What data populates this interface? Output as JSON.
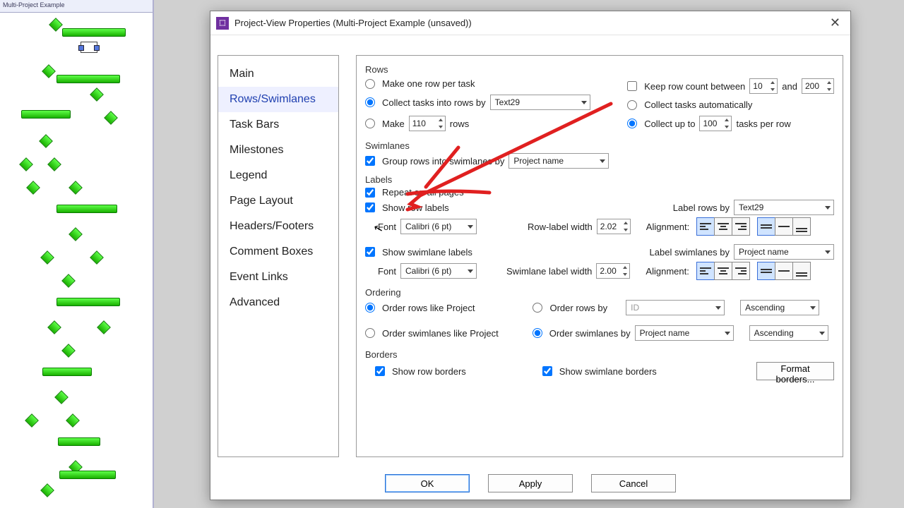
{
  "bg": {
    "title": "Multi-Project Example"
  },
  "dialog": {
    "title": "Project-View Properties (Multi-Project Example (unsaved))",
    "nav": [
      "Main",
      "Rows/Swimlanes",
      "Task Bars",
      "Milestones",
      "Legend",
      "Page Layout",
      "Headers/Footers",
      "Comment Boxes",
      "Event Links",
      "Advanced"
    ],
    "nav_sel": 1,
    "rows": {
      "title": "Rows",
      "r1": "Make one row per task",
      "r2": "Collect tasks into rows by",
      "r2_dd": "Text29",
      "r3": "Make",
      "r3_val": "110",
      "r3_suffix": "rows",
      "keep": "Keep row count between",
      "keep_a": "10",
      "keep_and": "and",
      "keep_b": "200",
      "auto": "Collect tasks automatically",
      "upto": "Collect up to",
      "upto_val": "100",
      "upto_suffix": "tasks per row"
    },
    "swim": {
      "title": "Swimlanes",
      "group": "Group rows into swimlanes by",
      "dd": "Project name"
    },
    "labels": {
      "title": "Labels",
      "repeat": "Repeat on all pages",
      "showrow": "Show row labels",
      "font": "Font",
      "font_val": "Calibri (6 pt)",
      "rowby": "Label rows by",
      "rowby_dd": "Text29",
      "rlw": "Row-label width",
      "rlw_val": "2.02",
      "align": "Alignment:",
      "showswim": "Show swimlane labels",
      "swimby": "Label swimlanes by",
      "swimby_dd": "Project name",
      "slw": "Swimlane label width",
      "slw_val": "2.00"
    },
    "order": {
      "title": "Ordering",
      "r1": "Order rows like Project",
      "r2": "Order rows by",
      "r2_dd": "ID",
      "r2_dir": "Ascending",
      "s1": "Order swimlanes like Project",
      "s2": "Order swimlanes by",
      "s2_dd": "Project name",
      "s2_dir": "Ascending"
    },
    "borders": {
      "title": "Borders",
      "row": "Show row borders",
      "swim": "Show swimlane borders",
      "fmt": "Format borders..."
    },
    "buttons": {
      "ok": "OK",
      "apply": "Apply",
      "cancel": "Cancel"
    }
  }
}
